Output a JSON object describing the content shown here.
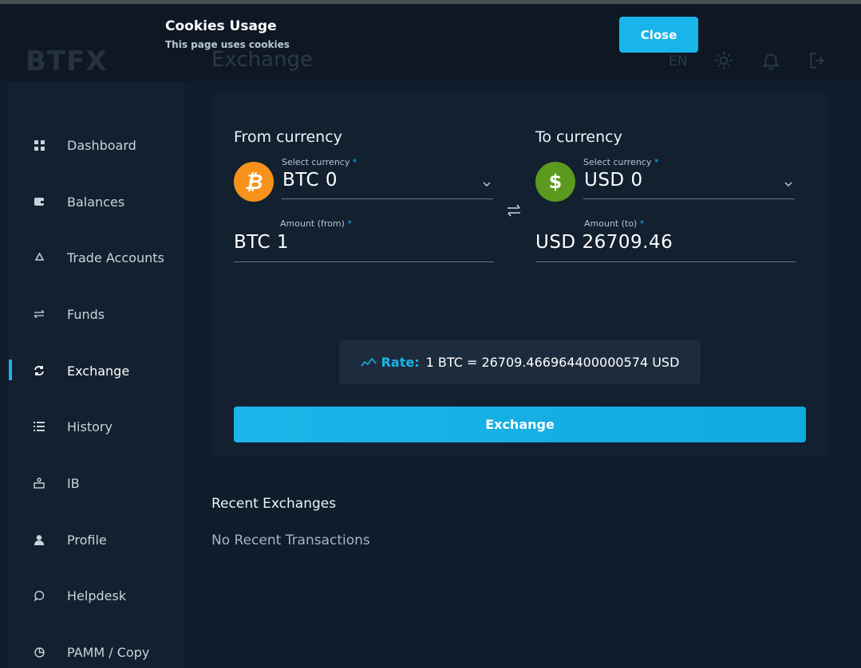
{
  "app": {
    "logo": "BTFX",
    "page_title": "Exchange",
    "language": "EN"
  },
  "cookie_banner": {
    "title": "Cookies Usage",
    "text": "This page uses cookies",
    "close_label": "Close"
  },
  "sidebar": {
    "items": [
      {
        "label": "Dashboard",
        "icon": "grid-icon",
        "active": false
      },
      {
        "label": "Balances",
        "icon": "wallet-icon",
        "active": false
      },
      {
        "label": "Trade Accounts",
        "icon": "recycle-icon",
        "active": false
      },
      {
        "label": "Funds",
        "icon": "transfer-icon",
        "active": false
      },
      {
        "label": "Exchange",
        "icon": "sync-icon",
        "active": true
      },
      {
        "label": "History",
        "icon": "list-icon",
        "active": false
      },
      {
        "label": "IB",
        "icon": "network-icon",
        "active": false
      },
      {
        "label": "Profile",
        "icon": "user-icon",
        "active": false
      },
      {
        "label": "Helpdesk",
        "icon": "chat-icon",
        "active": false
      },
      {
        "label": "PAMM / Copy",
        "icon": "pie-icon",
        "active": false
      }
    ]
  },
  "exchange": {
    "from": {
      "title": "From currency",
      "select_label": "Select currency",
      "selected": "BTC 0",
      "amount_label": "Amount (from)",
      "amount": "BTC 1",
      "coin_symbol": "₿",
      "coin_color": "#f7931a"
    },
    "to": {
      "title": "To currency",
      "select_label": "Select currency",
      "selected": "USD 0",
      "amount_label": "Amount (to)",
      "amount": "USD 26709.46",
      "coin_symbol": "$",
      "coin_color": "#5b9a1e"
    },
    "required_mark": "*",
    "rate_label": "Rate:",
    "rate_value": "1 BTC = 26709.466964400000574 USD",
    "submit_label": "Exchange"
  },
  "recent": {
    "title": "Recent Exchanges",
    "empty_text": "No Recent Transactions"
  },
  "colors": {
    "accent": "#19b4ea",
    "background": "#0f1c2b",
    "sidebar": "#13202f",
    "card": "#122030"
  }
}
